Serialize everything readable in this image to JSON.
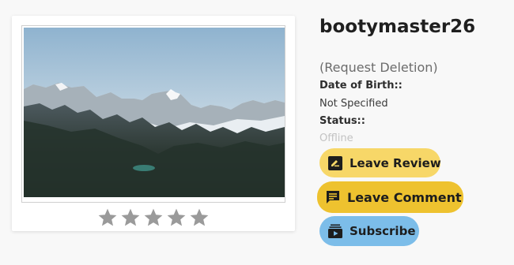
{
  "profile": {
    "username": "bootymaster26",
    "request_deletion": "(Request Deletion)",
    "dob_label": "Date of Birth::",
    "dob_value": "Not Specified",
    "status_label": "Status::",
    "status_value": "Offline",
    "rating": {
      "value": 0,
      "max": 5
    }
  },
  "actions": {
    "review_label": "Leave Review",
    "comment_label": "Leave Comment",
    "subscribe_label": "Subscribe"
  },
  "icons": {
    "review": "review-icon",
    "comment": "comment-icon",
    "subscribe": "subscription-icon",
    "star": "star-icon"
  },
  "colors": {
    "review_button": "#f7d768",
    "comment_button": "#eec22f",
    "subscribe_button": "#7cbde9",
    "star": "#9a9a9a",
    "status_offline": "#c3c3c3"
  }
}
